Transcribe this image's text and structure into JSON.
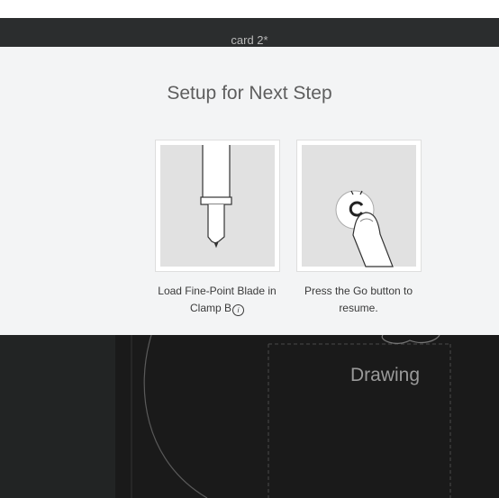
{
  "window": {
    "title": "card 2*"
  },
  "modal": {
    "title": "Setup for Next Step",
    "steps": [
      {
        "caption_line1": "Load Fine-Point Blade in",
        "caption_line2": "Clamp B",
        "icon": "info-icon",
        "illustration": "blade-illustration"
      },
      {
        "caption_line1": "Press the Go button to",
        "caption_line2": "resume.",
        "illustration": "go-button-press-illustration"
      }
    ]
  },
  "canvas": {
    "layer_label": "Drawing"
  },
  "colors": {
    "modal_bg": "#f3f4f5",
    "title_bar_bg": "#2b2d2e",
    "canvas_bg": "#1c1d1d"
  }
}
